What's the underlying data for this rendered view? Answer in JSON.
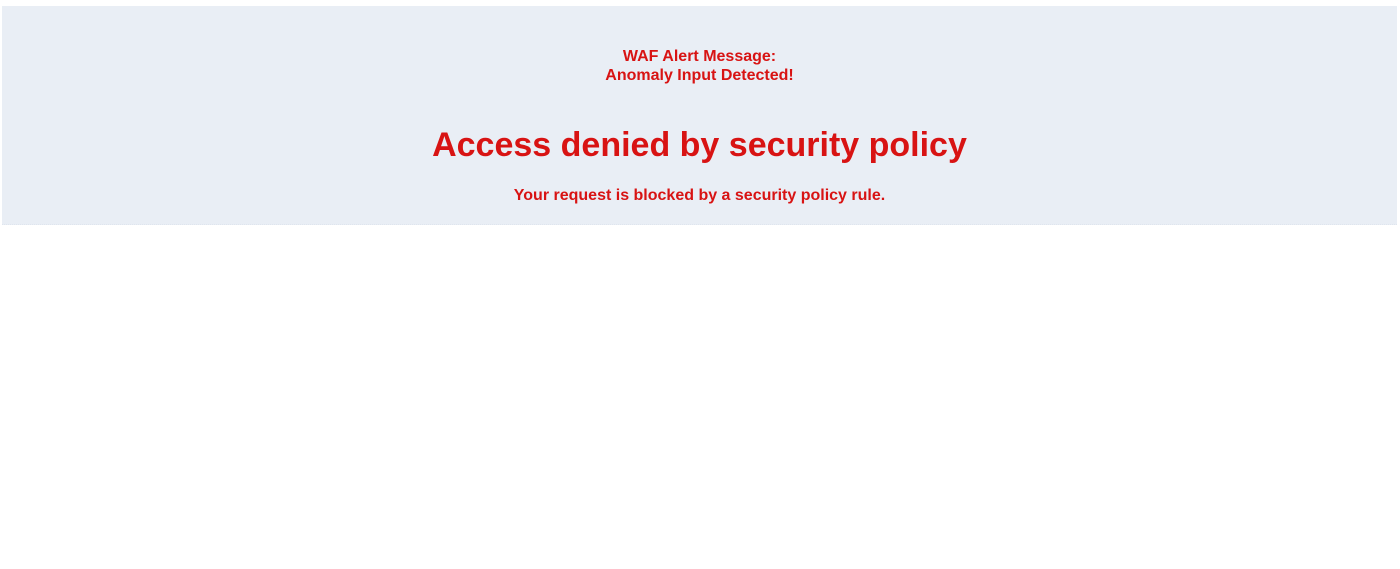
{
  "alert": {
    "line1": "WAF Alert Message:",
    "line2": "Anomaly Input Detected!"
  },
  "heading": "Access denied by security policy",
  "message": "Your request is blocked by a security policy rule.",
  "colors": {
    "text": "#d81313",
    "panel_background": "#e9eef5",
    "page_background": "#ffffff"
  }
}
